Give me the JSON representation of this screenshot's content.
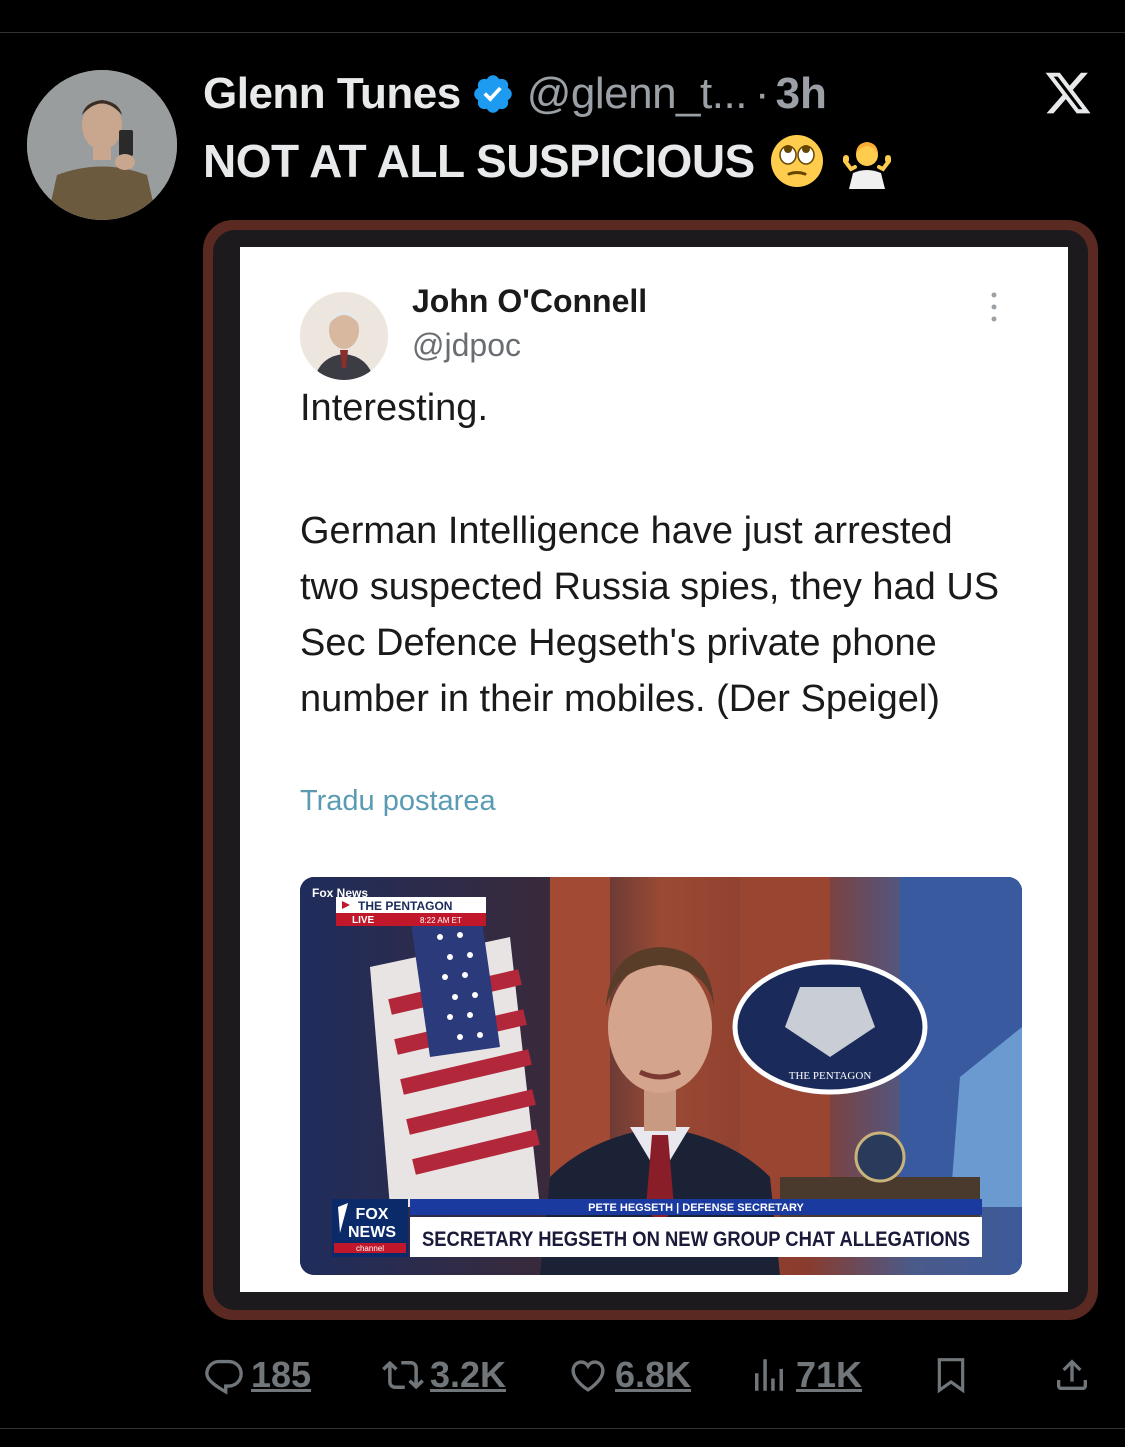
{
  "post": {
    "author_name": "Glenn Tunes",
    "handle": "@glenn_t...",
    "separator": "·",
    "time": "3h",
    "text": "NOT AT ALL SUSPICIOUS",
    "emojis": [
      "face-with-rolling-eyes",
      "person-shrugging"
    ]
  },
  "quoted_screenshot": {
    "author_name": "John O'Connell",
    "handle": "@jdpoc",
    "paragraph_1": "Interesting.",
    "paragraph_2": "German Intelligence have just arrested two suspected Russia spies, they had US Sec Defence Hegseth's private phone number in their mobiles. (Der Speigel)",
    "translate_link": "Tradu postarea",
    "news_image": {
      "network": "Fox News",
      "location_tag": "THE PENTAGON",
      "live_tag": "LIVE",
      "live_time": "8:22 AM ET",
      "podium_seal": "THE PENTAGON",
      "name_bar": "PETE HEGSETH | DEFENSE SECRETARY",
      "headline": "SECRETARY HEGSETH ON NEW GROUP CHAT ALLEGATIONS",
      "logo_top": "FOX",
      "logo_bottom": "NEWS",
      "logo_sub": "channel"
    }
  },
  "actions": {
    "replies": "185",
    "reposts": "3.2K",
    "likes": "6.8K",
    "views": "71K"
  },
  "colors": {
    "background": "#000000",
    "verified": "#1d9bf0",
    "muted": "#71767b",
    "media_frame": "#5a2a22"
  },
  "icons": [
    "verified-badge-icon",
    "x-logo-icon",
    "more-dots-icon",
    "reply-icon",
    "repost-icon",
    "like-icon",
    "views-icon",
    "bookmark-icon",
    "share-icon"
  ]
}
